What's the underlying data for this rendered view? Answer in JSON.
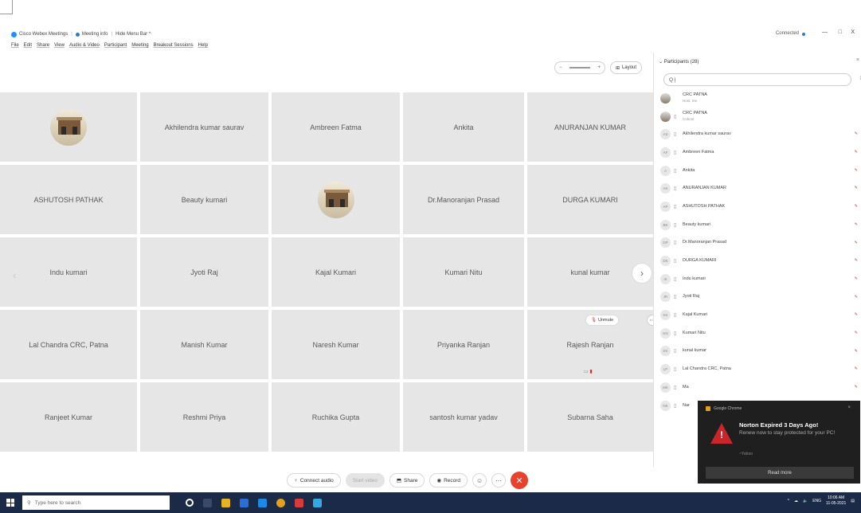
{
  "titlebar": {
    "app": "Cisco Webex Meetings",
    "meeting_info": "Meeting info",
    "hide_menu": "Hide Menu Bar ^",
    "status": "Connected",
    "win_min": "—",
    "win_max": "□",
    "win_close": "X"
  },
  "menu": [
    "File",
    "Edit",
    "Share",
    "View",
    "Audio & Video",
    "Participant",
    "Meeting",
    "Breakout Sessions",
    "Help"
  ],
  "toolbar": {
    "zoom_out": "−",
    "zoom_in": "+",
    "layout_label": "Layout"
  },
  "grid": {
    "tiles": [
      {
        "name": "",
        "image": true
      },
      {
        "name": "Akhilendra kumar saurav"
      },
      {
        "name": "Ambreen Fatma"
      },
      {
        "name": "Ankita"
      },
      {
        "name": "ANURANJAN KUMAR"
      },
      {
        "name": "ASHUTOSH PATHAK"
      },
      {
        "name": "Beauty kumari"
      },
      {
        "name": "",
        "image": true
      },
      {
        "name": "Dr.Manoranjan Prasad"
      },
      {
        "name": "DURGA KUMARI"
      },
      {
        "name": "Indu kumari"
      },
      {
        "name": "Jyoti Raj"
      },
      {
        "name": "Kajal Kumari"
      },
      {
        "name": "Kumari Nitu"
      },
      {
        "name": "kunal kumar"
      },
      {
        "name": "Lal Chandra CRC, Patna"
      },
      {
        "name": "Manish Kumar"
      },
      {
        "name": "Naresh Kumar"
      },
      {
        "name": "Priyanka Ranjan"
      },
      {
        "name": "Rajesh Ranjan"
      },
      {
        "name": "Ranjeet Kumar"
      },
      {
        "name": "Reshmi Priya"
      },
      {
        "name": "Ruchika Gupta"
      },
      {
        "name": "santosh kumar yadav"
      },
      {
        "name": "Subarna Saha"
      }
    ],
    "prev_glyph": "‹",
    "next_glyph": "›",
    "unmute_label": "Unmute"
  },
  "controls": {
    "connect_audio": "Connect audio",
    "start_video": "Start video",
    "share": "Share",
    "record": "Record"
  },
  "panel": {
    "title": "Participants (28)",
    "search_placeholder": "Q |",
    "participants": [
      {
        "initials": "",
        "name": "CRC PATNA",
        "sub": "Host, me",
        "image": true,
        "muted": false
      },
      {
        "initials": "",
        "name": "CRC PATNA",
        "sub": "Cohost",
        "image": true,
        "muted": false
      },
      {
        "initials": "AS",
        "name": "Akhilendra kumar saurav",
        "muted": true
      },
      {
        "initials": "AF",
        "name": "Ambreen Fatma",
        "muted": true
      },
      {
        "initials": "A",
        "name": "Ankita",
        "muted": true
      },
      {
        "initials": "AK",
        "name": "ANURANJAN KUMAR",
        "muted": true
      },
      {
        "initials": "AP",
        "name": "ASHUTOSH PATHAK",
        "muted": true
      },
      {
        "initials": "BK",
        "name": "Beauty kumari",
        "muted": true
      },
      {
        "initials": "DP",
        "name": "Dr.Manoranjan Prasad",
        "muted": true
      },
      {
        "initials": "DK",
        "name": "DURGA KUMARI",
        "muted": true
      },
      {
        "initials": "IK",
        "name": "Indu kumari",
        "muted": true
      },
      {
        "initials": "JR",
        "name": "Jyoti Raj",
        "muted": true
      },
      {
        "initials": "KK",
        "name": "Kajal Kumari",
        "muted": true
      },
      {
        "initials": "KN",
        "name": "Kumari Nitu",
        "muted": true
      },
      {
        "initials": "KK",
        "name": "kunal kumar",
        "muted": true
      },
      {
        "initials": "LP",
        "name": "Lal Chandra CRC, Patna",
        "muted": true
      },
      {
        "initials": "MK",
        "name": "Ma",
        "muted": true
      },
      {
        "initials": "NK",
        "name": "Nar",
        "muted": true
      }
    ]
  },
  "toast": {
    "app": "Google Chrome",
    "title": "Norton Expired 3 Days Ago!",
    "body": "Renew now to stay protected for your PC!",
    "source": "~Yahoo",
    "button": "Read more",
    "close": "×"
  },
  "taskbar": {
    "search_placeholder": "Type here to search",
    "lang": "ENG",
    "time": "10:06 AM",
    "date": "11-05-2021"
  },
  "colors": {
    "tile_bg": "#e6e6e6",
    "end_call": "#e8412c",
    "taskbar": "#1b2a46",
    "mute_red": "#d03030"
  }
}
